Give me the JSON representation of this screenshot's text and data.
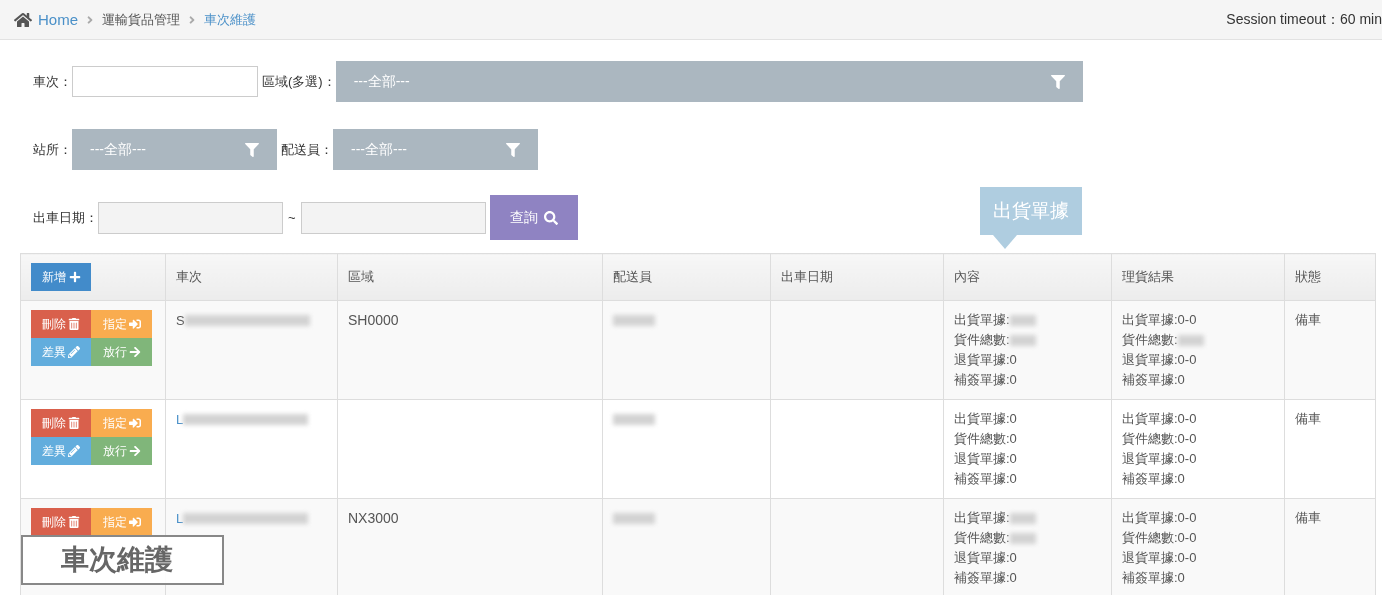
{
  "breadcrumb": [
    {
      "label": "Home",
      "kind": "home"
    },
    {
      "label": "運輸貨品管理",
      "kind": "text"
    },
    {
      "label": "車次維護",
      "kind": "current"
    }
  ],
  "session": "Session timeout：60 min",
  "filters": {
    "trip": {
      "label": "車次："
    },
    "area": {
      "label": "區域(多選)：",
      "value": "---全部---"
    },
    "station": {
      "label": "站所：",
      "value": "---全部---"
    },
    "driver": {
      "label": "配送員：",
      "value": "---全部---"
    },
    "date": {
      "label": "出車日期：",
      "separator": "~"
    },
    "search": "查詢"
  },
  "tooltip": "出貨單據",
  "table": {
    "add_button": "新增",
    "columns": [
      "車次",
      "區域",
      "配送員",
      "出車日期",
      "內容",
      "理貨結果",
      "狀態"
    ],
    "rows": [
      {
        "actions": [
          {
            "label": "刪除",
            "kind": "delete"
          },
          {
            "label": "指定",
            "kind": "assign"
          },
          {
            "label": "差異",
            "kind": "diff"
          },
          {
            "label": "放行",
            "kind": "release"
          }
        ],
        "trip": {
          "text": "S",
          "link": false,
          "redacted": true
        },
        "area": "SH0000",
        "driver": {
          "redacted": true
        },
        "content": [
          {
            "text": "出貨單據:",
            "redacted": true
          },
          {
            "text": "貨件總數:",
            "redacted": true
          },
          {
            "text": "退貨單據:0",
            "redacted": false
          },
          {
            "text": "補簽單據:0",
            "redacted": false
          }
        ],
        "result": [
          {
            "text": "出貨單據:0-0",
            "redacted": false
          },
          {
            "text": "貨件總數:",
            "redacted": true
          },
          {
            "text": "退貨單據:0-0",
            "redacted": false
          },
          {
            "text": "補簽單據:0",
            "redacted": false
          }
        ],
        "status": "備車"
      },
      {
        "actions": [
          {
            "label": "刪除",
            "kind": "delete"
          },
          {
            "label": "指定",
            "kind": "assign"
          },
          {
            "label": "差異",
            "kind": "diff"
          },
          {
            "label": "放行",
            "kind": "release"
          }
        ],
        "trip": {
          "text": "L",
          "link": true,
          "redacted": true
        },
        "driver": {
          "redacted": true
        },
        "content": [
          {
            "text": "出貨單據:0",
            "redacted": false
          },
          {
            "text": "貨件總數:0",
            "redacted": false
          },
          {
            "text": "退貨單據:0",
            "redacted": false
          },
          {
            "text": "補簽單據:0",
            "redacted": false
          }
        ],
        "result": [
          {
            "text": "出貨單據:0-0",
            "redacted": false
          },
          {
            "text": "貨件總數:0-0",
            "redacted": false
          },
          {
            "text": "退貨單據:0-0",
            "redacted": false
          },
          {
            "text": "補簽單據:0",
            "redacted": false
          }
        ],
        "status": "備車"
      },
      {
        "actions": [
          {
            "label": "刪除",
            "kind": "delete"
          },
          {
            "label": "指定",
            "kind": "assign"
          }
        ],
        "trip": {
          "text": "L",
          "link": true,
          "redacted": true
        },
        "area": "NX3000",
        "driver": {
          "redacted": true
        },
        "content": [
          {
            "text": "出貨單據:",
            "redacted": true
          },
          {
            "text": "貨件總數:",
            "redacted": true
          },
          {
            "text": "退貨單據:0",
            "redacted": false
          },
          {
            "text": "補簽單據:0",
            "redacted": false
          }
        ],
        "result": [
          {
            "text": "出貨單據:0-0",
            "redacted": false
          },
          {
            "text": "貨件總數:0-0",
            "redacted": false
          },
          {
            "text": "退貨單據:0-0",
            "redacted": false
          },
          {
            "text": "補簽單據:0",
            "redacted": false
          }
        ],
        "status": "備車"
      }
    ]
  },
  "overlay_label": "車次維護"
}
